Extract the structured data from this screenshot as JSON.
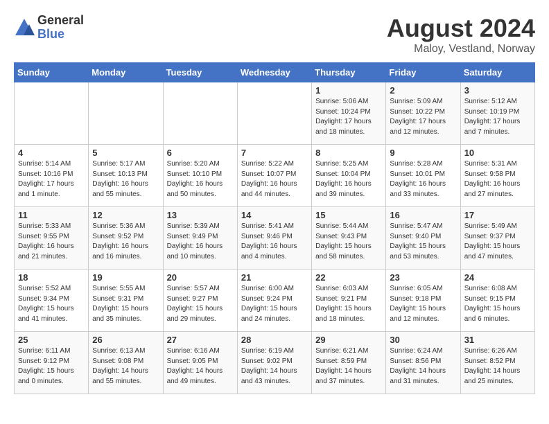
{
  "header": {
    "logo_general": "General",
    "logo_blue": "Blue",
    "month_title": "August 2024",
    "location": "Maloy, Vestland, Norway"
  },
  "weekdays": [
    "Sunday",
    "Monday",
    "Tuesday",
    "Wednesday",
    "Thursday",
    "Friday",
    "Saturday"
  ],
  "weeks": [
    [
      {
        "day": "",
        "detail": ""
      },
      {
        "day": "",
        "detail": ""
      },
      {
        "day": "",
        "detail": ""
      },
      {
        "day": "",
        "detail": ""
      },
      {
        "day": "1",
        "detail": "Sunrise: 5:06 AM\nSunset: 10:24 PM\nDaylight: 17 hours\nand 18 minutes."
      },
      {
        "day": "2",
        "detail": "Sunrise: 5:09 AM\nSunset: 10:22 PM\nDaylight: 17 hours\nand 12 minutes."
      },
      {
        "day": "3",
        "detail": "Sunrise: 5:12 AM\nSunset: 10:19 PM\nDaylight: 17 hours\nand 7 minutes."
      }
    ],
    [
      {
        "day": "4",
        "detail": "Sunrise: 5:14 AM\nSunset: 10:16 PM\nDaylight: 17 hours\nand 1 minute."
      },
      {
        "day": "5",
        "detail": "Sunrise: 5:17 AM\nSunset: 10:13 PM\nDaylight: 16 hours\nand 55 minutes."
      },
      {
        "day": "6",
        "detail": "Sunrise: 5:20 AM\nSunset: 10:10 PM\nDaylight: 16 hours\nand 50 minutes."
      },
      {
        "day": "7",
        "detail": "Sunrise: 5:22 AM\nSunset: 10:07 PM\nDaylight: 16 hours\nand 44 minutes."
      },
      {
        "day": "8",
        "detail": "Sunrise: 5:25 AM\nSunset: 10:04 PM\nDaylight: 16 hours\nand 39 minutes."
      },
      {
        "day": "9",
        "detail": "Sunrise: 5:28 AM\nSunset: 10:01 PM\nDaylight: 16 hours\nand 33 minutes."
      },
      {
        "day": "10",
        "detail": "Sunrise: 5:31 AM\nSunset: 9:58 PM\nDaylight: 16 hours\nand 27 minutes."
      }
    ],
    [
      {
        "day": "11",
        "detail": "Sunrise: 5:33 AM\nSunset: 9:55 PM\nDaylight: 16 hours\nand 21 minutes."
      },
      {
        "day": "12",
        "detail": "Sunrise: 5:36 AM\nSunset: 9:52 PM\nDaylight: 16 hours\nand 16 minutes."
      },
      {
        "day": "13",
        "detail": "Sunrise: 5:39 AM\nSunset: 9:49 PM\nDaylight: 16 hours\nand 10 minutes."
      },
      {
        "day": "14",
        "detail": "Sunrise: 5:41 AM\nSunset: 9:46 PM\nDaylight: 16 hours\nand 4 minutes."
      },
      {
        "day": "15",
        "detail": "Sunrise: 5:44 AM\nSunset: 9:43 PM\nDaylight: 15 hours\nand 58 minutes."
      },
      {
        "day": "16",
        "detail": "Sunrise: 5:47 AM\nSunset: 9:40 PM\nDaylight: 15 hours\nand 53 minutes."
      },
      {
        "day": "17",
        "detail": "Sunrise: 5:49 AM\nSunset: 9:37 PM\nDaylight: 15 hours\nand 47 minutes."
      }
    ],
    [
      {
        "day": "18",
        "detail": "Sunrise: 5:52 AM\nSunset: 9:34 PM\nDaylight: 15 hours\nand 41 minutes."
      },
      {
        "day": "19",
        "detail": "Sunrise: 5:55 AM\nSunset: 9:31 PM\nDaylight: 15 hours\nand 35 minutes."
      },
      {
        "day": "20",
        "detail": "Sunrise: 5:57 AM\nSunset: 9:27 PM\nDaylight: 15 hours\nand 29 minutes."
      },
      {
        "day": "21",
        "detail": "Sunrise: 6:00 AM\nSunset: 9:24 PM\nDaylight: 15 hours\nand 24 minutes."
      },
      {
        "day": "22",
        "detail": "Sunrise: 6:03 AM\nSunset: 9:21 PM\nDaylight: 15 hours\nand 18 minutes."
      },
      {
        "day": "23",
        "detail": "Sunrise: 6:05 AM\nSunset: 9:18 PM\nDaylight: 15 hours\nand 12 minutes."
      },
      {
        "day": "24",
        "detail": "Sunrise: 6:08 AM\nSunset: 9:15 PM\nDaylight: 15 hours\nand 6 minutes."
      }
    ],
    [
      {
        "day": "25",
        "detail": "Sunrise: 6:11 AM\nSunset: 9:12 PM\nDaylight: 15 hours\nand 0 minutes."
      },
      {
        "day": "26",
        "detail": "Sunrise: 6:13 AM\nSunset: 9:08 PM\nDaylight: 14 hours\nand 55 minutes."
      },
      {
        "day": "27",
        "detail": "Sunrise: 6:16 AM\nSunset: 9:05 PM\nDaylight: 14 hours\nand 49 minutes."
      },
      {
        "day": "28",
        "detail": "Sunrise: 6:19 AM\nSunset: 9:02 PM\nDaylight: 14 hours\nand 43 minutes."
      },
      {
        "day": "29",
        "detail": "Sunrise: 6:21 AM\nSunset: 8:59 PM\nDaylight: 14 hours\nand 37 minutes."
      },
      {
        "day": "30",
        "detail": "Sunrise: 6:24 AM\nSunset: 8:56 PM\nDaylight: 14 hours\nand 31 minutes."
      },
      {
        "day": "31",
        "detail": "Sunrise: 6:26 AM\nSunset: 8:52 PM\nDaylight: 14 hours\nand 25 minutes."
      }
    ]
  ]
}
